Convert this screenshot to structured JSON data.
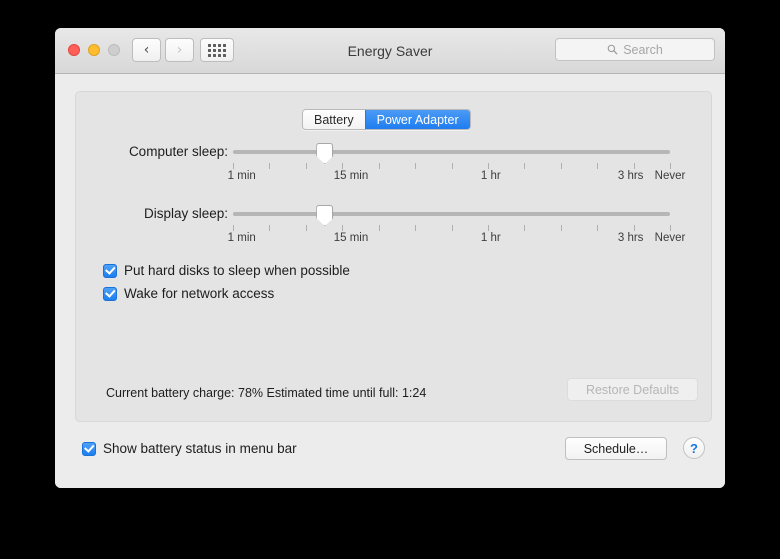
{
  "window": {
    "title": "Energy Saver",
    "traffic_lights": [
      "close-light",
      "minimize-light",
      "zoom-light"
    ],
    "nav": {
      "back": "‹",
      "forward": "›",
      "grid": "show-all-icon"
    },
    "search": {
      "placeholder": "Search",
      "value": "",
      "icon": "search-icon"
    }
  },
  "tabs": {
    "items": [
      {
        "label": "Battery",
        "selected": false
      },
      {
        "label": "Power Adapter",
        "selected": true
      }
    ]
  },
  "sliders": [
    {
      "name": "computer-sleep",
      "label": "Computer sleep:",
      "value_percent": 21,
      "tick_count": 13,
      "tick_labels": [
        {
          "text": "1 min",
          "percent": 2
        },
        {
          "text": "15 min",
          "percent": 27
        },
        {
          "text": "1 hr",
          "percent": 59
        },
        {
          "text": "3 hrs",
          "percent": 91
        },
        {
          "text": "Never",
          "percent": 100
        }
      ]
    },
    {
      "name": "display-sleep",
      "label": "Display sleep:",
      "value_percent": 21,
      "tick_count": 13,
      "tick_labels": [
        {
          "text": "1 min",
          "percent": 2
        },
        {
          "text": "15 min",
          "percent": 27
        },
        {
          "text": "1 hr",
          "percent": 59
        },
        {
          "text": "3 hrs",
          "percent": 91
        },
        {
          "text": "Never",
          "percent": 100
        }
      ]
    }
  ],
  "checkboxes": [
    {
      "name": "put-hard-disks-to-sleep",
      "label": "Put hard disks to sleep when possible",
      "checked": true
    },
    {
      "name": "wake-for-network-access",
      "label": "Wake for network access",
      "checked": true
    }
  ],
  "status": {
    "text": "Current battery charge: 78%  Estimated time until full: 1:24",
    "battery_charge": "78%",
    "time_until_full": "1:24"
  },
  "buttons": {
    "restore_defaults": "Restore Defaults",
    "schedule": "Schedule…",
    "help": "?"
  },
  "bottom": {
    "show_battery_status": {
      "label": "Show battery status in menu bar",
      "checked": true
    }
  },
  "colors": {
    "accent_blue": "#1f7df0",
    "window_bg": "#ececec",
    "panel_bg": "#e4e4e4",
    "help_blue": "#1977e0"
  }
}
